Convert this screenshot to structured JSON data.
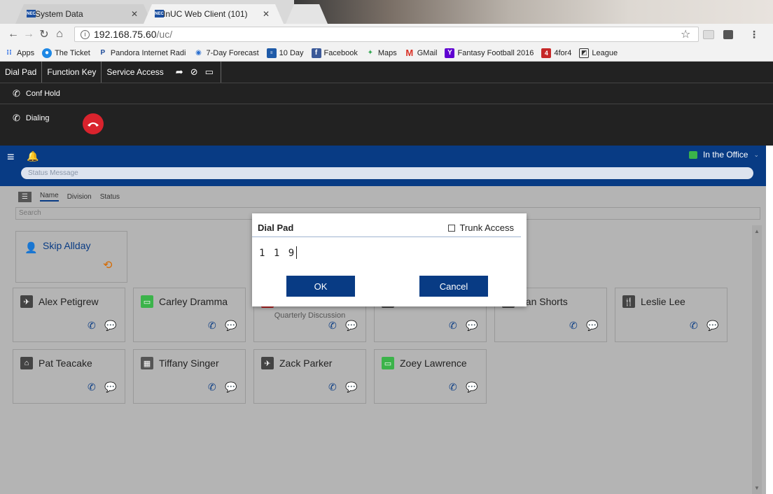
{
  "browser": {
    "tabs": [
      {
        "label": "System Data",
        "favicon": "NEC"
      },
      {
        "label": "InUC Web Client (101)",
        "favicon": "NEC"
      }
    ],
    "url": {
      "host": "192.168.75.60",
      "path": "/uc/"
    },
    "bookmarks": [
      {
        "label": "Apps",
        "icon": "apps-grid-icon",
        "color": "#3b78e7"
      },
      {
        "label": "The Ticket",
        "icon": "ticket-icon",
        "color": "#1e88e5"
      },
      {
        "label": "Pandora Internet Radi",
        "icon": "pandora-icon",
        "color": "#1d4b9a"
      },
      {
        "label": "7-Day Forecast",
        "icon": "weather-icon",
        "color": "#2a6fd0"
      },
      {
        "label": "10 Day",
        "icon": "calendar-icon",
        "color": "#1e5aa8"
      },
      {
        "label": "Facebook",
        "icon": "facebook-icon",
        "color": "#3b5998"
      },
      {
        "label": "Maps",
        "icon": "maps-icon",
        "color": "#34a853"
      },
      {
        "label": "GMail",
        "icon": "gmail-icon",
        "color": "#d93025"
      },
      {
        "label": "Fantasy Football 2016",
        "icon": "yahoo-icon",
        "color": "#5f01d1"
      },
      {
        "label": "4for4",
        "icon": "fourfor4-icon",
        "color": "#c62828"
      },
      {
        "label": "League",
        "icon": "league-icon",
        "color": "#333333"
      }
    ]
  },
  "app": {
    "toolbar": {
      "dial_pad": "Dial Pad",
      "function_key": "Function Key",
      "service_access": "Service Access"
    },
    "conf_hold": "Conf Hold",
    "dialing": "Dialing",
    "presence": "In the Office",
    "status_message_placeholder": "Status Message",
    "sort": {
      "name": "Name",
      "division": "Division",
      "status": "Status"
    },
    "search_placeholder": "Search",
    "self_card": {
      "name": "Skip Allday"
    },
    "contacts": [
      {
        "name": "Alex Petigrew",
        "status_color": "#444444",
        "status_icon": "airplane-icon"
      },
      {
        "name": "Carley Dramma",
        "status_color": "#3bb34a",
        "status_icon": "monitor-icon"
      },
      {
        "name": "",
        "subtitle": "Quarterly Discussion",
        "status_color": "#b22222",
        "status_icon": "meeting-icon"
      },
      {
        "name": "",
        "status_color": "#444444",
        "status_icon": "unknown-icon"
      },
      {
        "name": "ean Shorts",
        "status_color": "#444444",
        "status_icon": "unknown-icon"
      },
      {
        "name": "Leslie Lee",
        "status_color": "#444444",
        "status_icon": "dining-icon"
      },
      {
        "name": "Pat Teacake",
        "status_color": "#444444",
        "status_icon": "home-icon"
      },
      {
        "name": "Tiffany Singer",
        "status_color": "#555555",
        "status_icon": "calendar-icon"
      },
      {
        "name": "Zack Parker",
        "status_color": "#444444",
        "status_icon": "airplane-icon"
      },
      {
        "name": "Zoey Lawrence",
        "status_color": "#3bb34a",
        "status_icon": "monitor-icon"
      }
    ]
  },
  "modal": {
    "title": "Dial Pad",
    "trunk_access": "Trunk Access",
    "input_value": "1 1 9",
    "ok": "OK",
    "cancel": "Cancel"
  },
  "colors": {
    "brand": "#083b84",
    "hangup": "#d9232d",
    "available": "#3bb34a",
    "alert": "#f0a91d"
  }
}
